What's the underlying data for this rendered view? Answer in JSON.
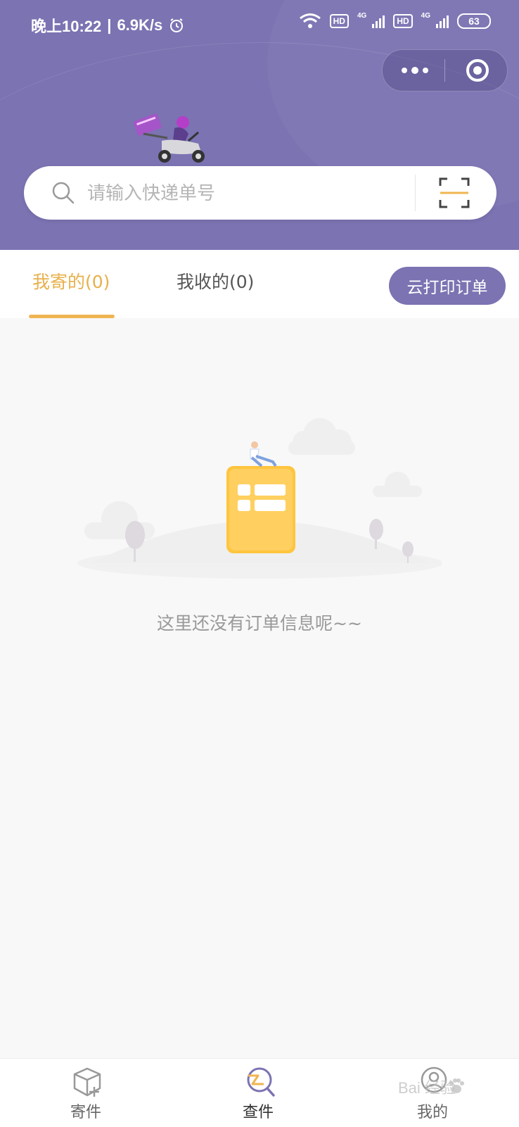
{
  "status_bar": {
    "time": "晚上10:22",
    "network_speed": "6.9K/s",
    "hd1": "HD",
    "net1": "4G",
    "hd2": "HD",
    "net2": "4G",
    "battery": "63"
  },
  "search": {
    "placeholder": "请输入快递单号"
  },
  "tabs": [
    {
      "label": "我寄的(0)",
      "active": true
    },
    {
      "label": "我收的(0)",
      "active": false
    }
  ],
  "print_button_label": "云打印订单",
  "empty_state": {
    "text": "这里还没有订单信息呢~~"
  },
  "tab_bar": [
    {
      "label": "寄件",
      "icon": "box-plus-icon",
      "active": false
    },
    {
      "label": "查件",
      "icon": "search-parcel-icon",
      "active": true
    },
    {
      "label": "我的",
      "icon": "profile-icon",
      "active": false
    }
  ],
  "watermark": "Bai 经验",
  "colors": {
    "header_bg": "#7b73b2",
    "active_tab": "#e8b04b",
    "print_button": "#7b73b2",
    "page_bg": "#f8f8f8"
  }
}
